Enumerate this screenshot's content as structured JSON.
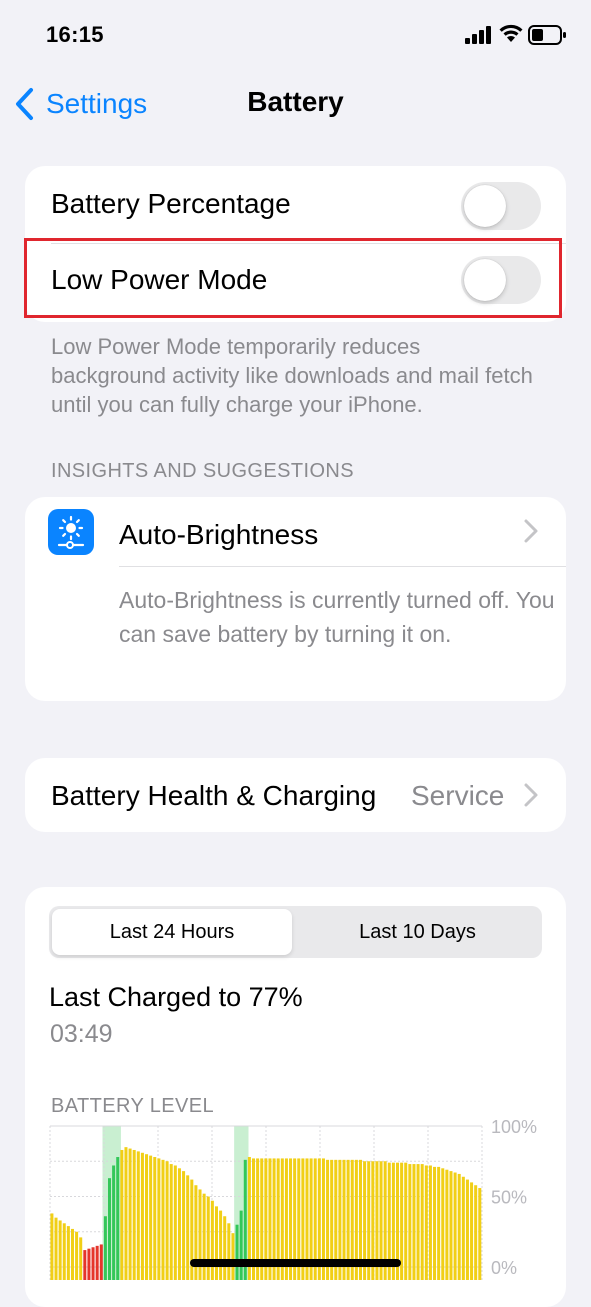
{
  "status_bar": {
    "time": "16:15",
    "icons": [
      "cellular-signal-icon",
      "wifi-icon",
      "battery-icon"
    ]
  },
  "nav": {
    "back_label": "Settings",
    "title": "Battery",
    "back_icon": "chevron-left-icon"
  },
  "toggles": [
    {
      "label": "Battery Percentage",
      "on": false
    },
    {
      "label": "Low Power Mode",
      "on": false,
      "highlighted": true
    }
  ],
  "low_power_footnote": "Low Power Mode temporarily reduces background activity like downloads and mail fetch until you can fully charge your iPhone.",
  "insights": {
    "header": "INSIGHTS AND SUGGESTIONS",
    "title": "Auto-Brightness",
    "icon": "sun-brightness-icon",
    "description": "Auto-Brightness is currently turned off. You can save battery by turning it on."
  },
  "battery_health": {
    "label": "Battery Health & Charging",
    "value": "Service"
  },
  "usage": {
    "tabs": [
      "Last 24 Hours",
      "Last 10 Days"
    ],
    "selected_tab": "Last 24 Hours",
    "last_charged_label": "Last Charged to 77%",
    "last_charged_time": "03:49"
  },
  "colors": {
    "accent": "#0a84ff",
    "bar_normal": "#f1cf16",
    "bar_low": "#e5352b",
    "bar_charging": "#33c759",
    "charging_band": "#c9efd1",
    "highlight_box": "#e0262e"
  },
  "chart_data": {
    "type": "bar",
    "title": "BATTERY LEVEL",
    "y_tick_labels": [
      "100%",
      "50%",
      "0%"
    ],
    "ylim": [
      0,
      100
    ],
    "grid": true,
    "values": [
      38,
      35,
      33,
      31,
      29,
      27,
      25,
      21,
      12,
      13,
      14,
      15,
      16,
      36,
      63,
      72,
      78,
      83,
      85,
      84,
      83,
      82,
      81,
      80,
      79,
      78,
      77,
      76,
      75,
      73,
      72,
      70,
      68,
      65,
      62,
      58,
      55,
      52,
      50,
      47,
      43,
      40,
      36,
      31,
      24,
      30,
      40,
      76,
      78,
      77,
      77,
      77,
      77,
      77,
      77,
      77,
      77,
      77,
      77,
      77,
      77,
      77,
      77,
      77,
      77,
      77,
      77,
      76,
      76,
      76,
      76,
      76,
      76,
      76,
      76,
      76,
      75,
      75,
      75,
      75,
      75,
      75,
      74,
      74,
      74,
      74,
      74,
      73,
      73,
      73,
      73,
      72,
      72,
      71,
      71,
      70,
      69,
      68,
      67,
      66,
      64,
      62,
      60,
      58,
      56
    ],
    "status": [
      "n",
      "n",
      "n",
      "n",
      "n",
      "n",
      "n",
      "n",
      "l",
      "l",
      "l",
      "l",
      "l",
      "c",
      "c",
      "c",
      "c",
      "n",
      "n",
      "n",
      "n",
      "n",
      "n",
      "n",
      "n",
      "n",
      "n",
      "n",
      "n",
      "n",
      "n",
      "n",
      "n",
      "n",
      "n",
      "n",
      "n",
      "n",
      "n",
      "n",
      "n",
      "n",
      "n",
      "n",
      "n",
      "c",
      "c",
      "c",
      "n",
      "n",
      "n",
      "n",
      "n",
      "n",
      "n",
      "n",
      "n",
      "n",
      "n",
      "n",
      "n",
      "n",
      "n",
      "n",
      "n",
      "n",
      "n",
      "n",
      "n",
      "n",
      "n",
      "n",
      "n",
      "n",
      "n",
      "n",
      "n",
      "n",
      "n",
      "n",
      "n",
      "n",
      "n",
      "n",
      "n",
      "n",
      "n",
      "n",
      "n",
      "n",
      "n",
      "n",
      "n",
      "n",
      "n",
      "n",
      "n",
      "n",
      "n",
      "n",
      "n",
      "n",
      "n",
      "n",
      "n"
    ],
    "charging_bands": [
      [
        13,
        17
      ],
      [
        45,
        48
      ]
    ]
  }
}
